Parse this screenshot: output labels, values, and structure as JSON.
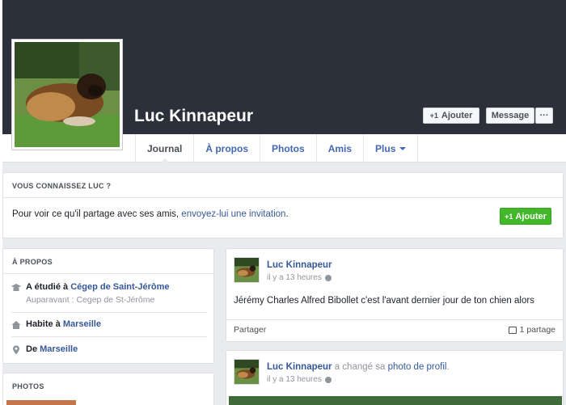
{
  "profile": {
    "name": "Luc Kinnapeur",
    "add_friend_label": "Ajouter",
    "message_label": "Message",
    "more_label": "···"
  },
  "nav": {
    "tabs": [
      {
        "label": "Journal",
        "active": true
      },
      {
        "label": "À propos"
      },
      {
        "label": "Photos"
      },
      {
        "label": "Amis"
      },
      {
        "label": "Plus"
      }
    ]
  },
  "know": {
    "title": "VOUS CONNAISSEZ LUC ?",
    "text_before": "Pour voir ce qu'il partage avec ses amis, ",
    "link": "envoyez-lui une invitation",
    "text_after": ".",
    "button_label": "Ajouter"
  },
  "about": {
    "title": "À PROPOS",
    "items": [
      {
        "icon": "school-icon",
        "prefix": "A étudié à ",
        "link": "Cégep de Saint-Jérôme",
        "sub": "Auparavant : Cegep de St-Jérôme"
      },
      {
        "icon": "home-icon",
        "prefix": "Habite à ",
        "link": "Marseille"
      },
      {
        "icon": "location-pin-icon",
        "prefix": "De ",
        "link": "Marseille"
      }
    ]
  },
  "photos": {
    "title": "PHOTOS"
  },
  "posts": [
    {
      "author": "Luc Kinnapeur",
      "time": "il y a 13 heures",
      "text": "Jérémy Charles Alfred Bibollet c'est l'avant dernier jour de ton chien alors",
      "share_label": "Partager",
      "shares_count": "1 partage"
    },
    {
      "author": "Luc Kinnapeur",
      "action_before": "a changé sa ",
      "action_link": "photo de profil",
      "action_after": ".",
      "time": "il y a 13 heures"
    }
  ],
  "colors": {
    "cover": "#2b303b",
    "link": "#365899",
    "green_button": "#42b72a",
    "page_bg": "#e9ebee"
  }
}
